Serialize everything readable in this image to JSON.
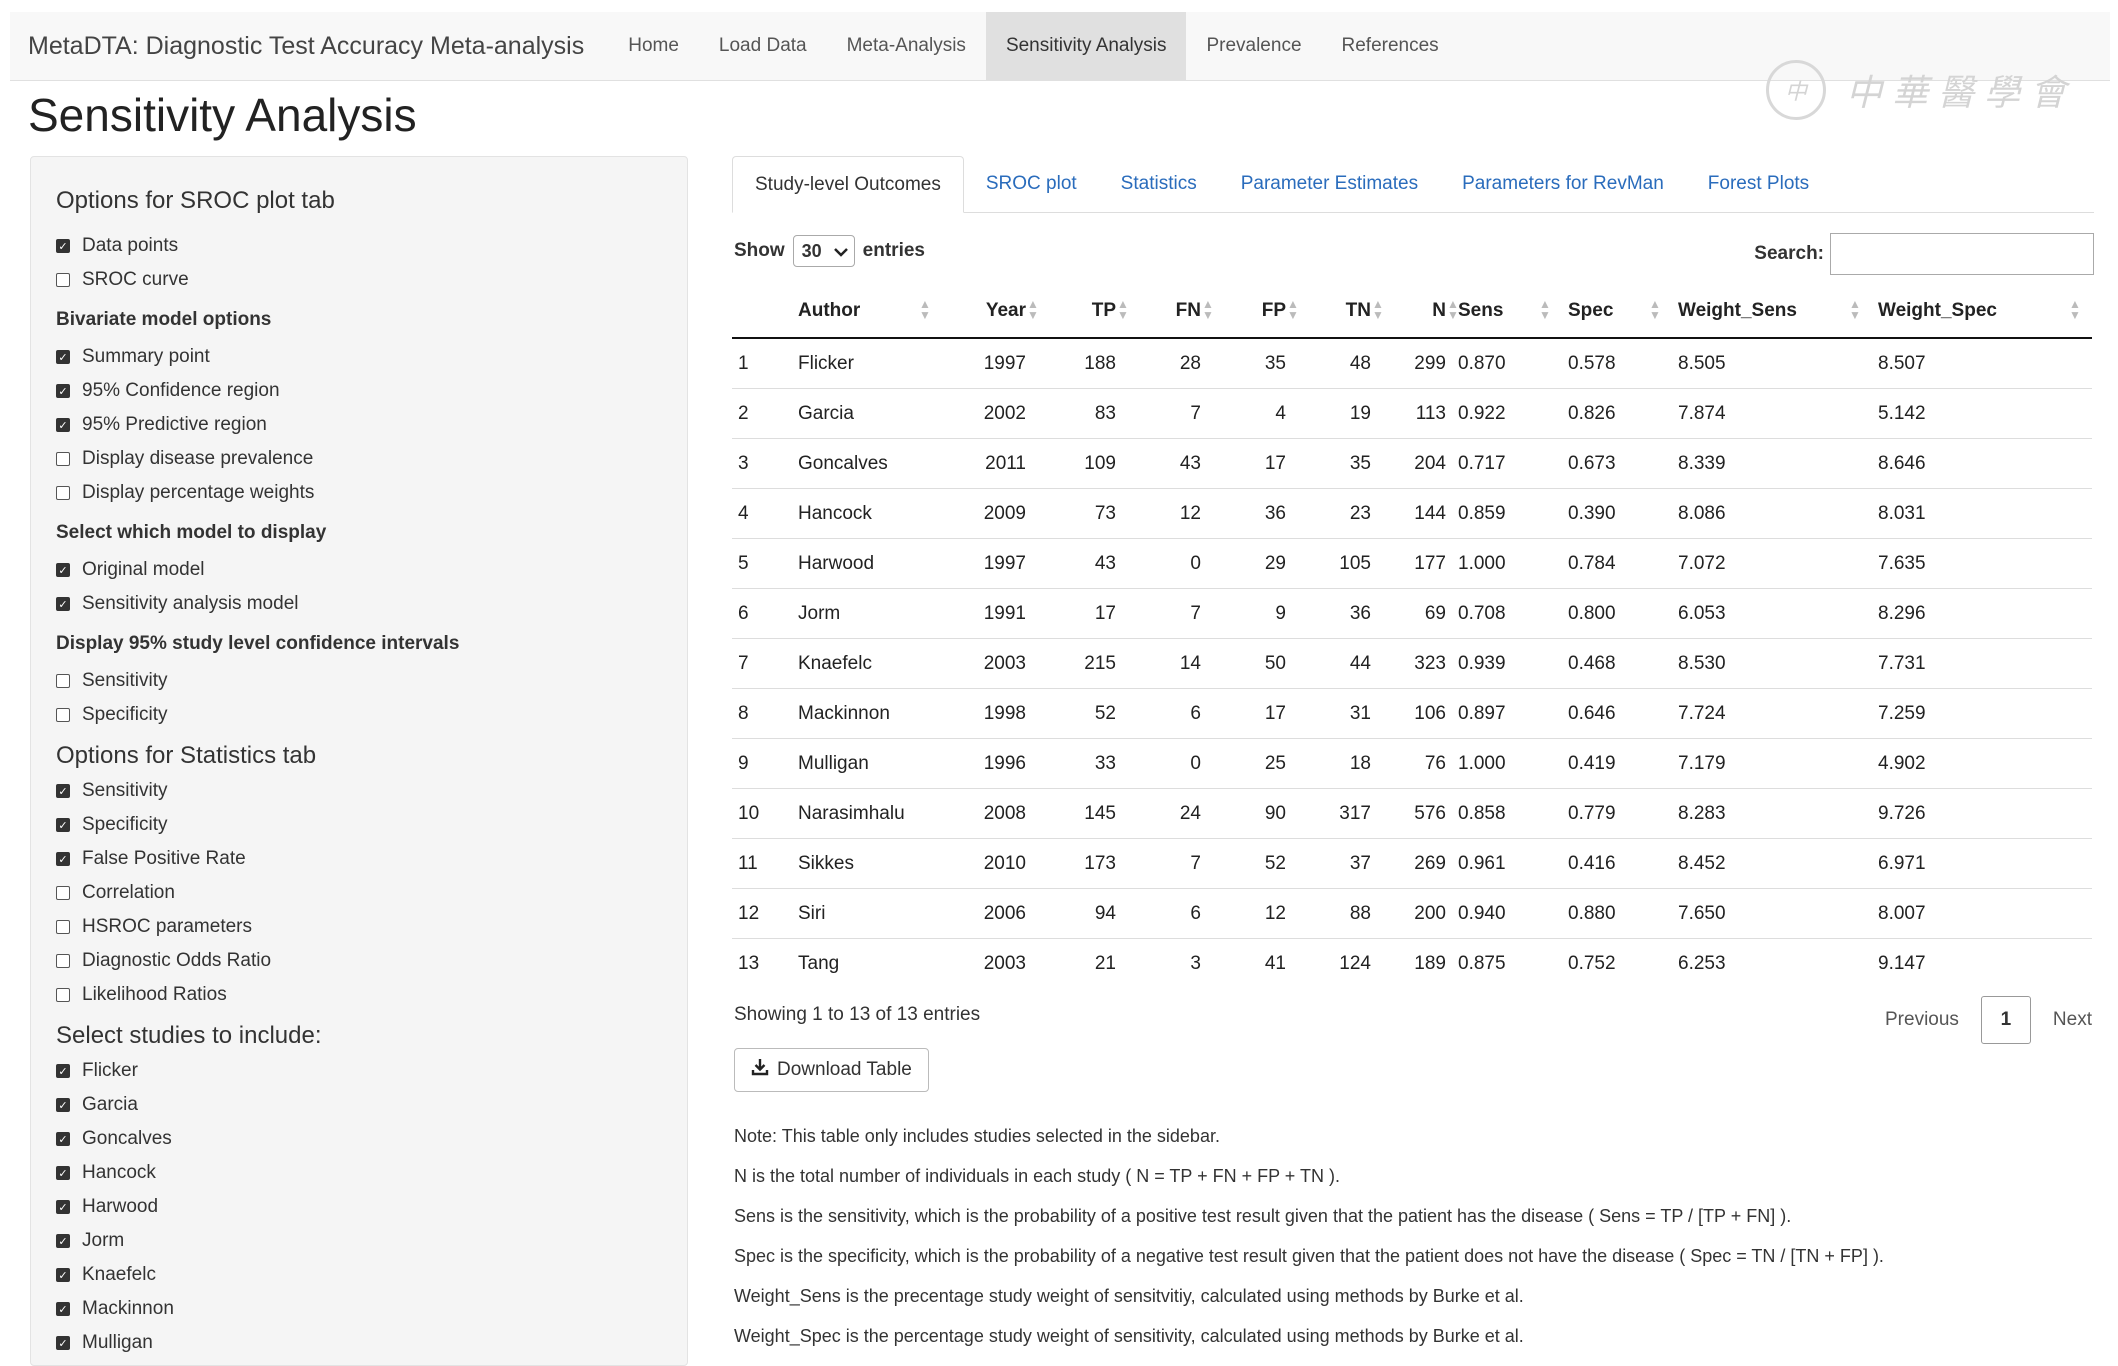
{
  "navbar": {
    "brand": "MetaDTA: Diagnostic Test Accuracy Meta-analysis",
    "items": [
      {
        "label": "Home",
        "active": false
      },
      {
        "label": "Load Data",
        "active": false
      },
      {
        "label": "Meta-Analysis",
        "active": false
      },
      {
        "label": "Sensitivity Analysis",
        "active": true
      },
      {
        "label": "Prevalence",
        "active": false
      },
      {
        "label": "References",
        "active": false
      }
    ]
  },
  "watermark": {
    "seal_text": "中",
    "text": "中華醫學會"
  },
  "page_title": "Sensitivity Analysis",
  "sidebar": {
    "sroc_title": "Options for SROC plot tab",
    "sroc_options": [
      {
        "label": "Data points",
        "checked": true
      },
      {
        "label": "SROC curve",
        "checked": false
      }
    ],
    "bivariate_title": "Bivariate model options",
    "bivariate_options": [
      {
        "label": "Summary point",
        "checked": true
      },
      {
        "label": "95% Confidence region",
        "checked": true
      },
      {
        "label": "95% Predictive region",
        "checked": true
      },
      {
        "label": "Display disease prevalence",
        "checked": false
      },
      {
        "label": "Display percentage weights",
        "checked": false
      }
    ],
    "model_title": "Select which model to display",
    "model_options": [
      {
        "label": "Original model",
        "checked": true
      },
      {
        "label": "Sensitivity analysis model",
        "checked": true
      }
    ],
    "ci_title": "Display 95% study level confidence intervals",
    "ci_options": [
      {
        "label": "Sensitivity",
        "checked": false
      },
      {
        "label": "Specificity",
        "checked": false
      }
    ],
    "stats_title": "Options for Statistics tab",
    "stats_options": [
      {
        "label": "Sensitivity",
        "checked": true
      },
      {
        "label": "Specificity",
        "checked": true
      },
      {
        "label": "False Positive Rate",
        "checked": true
      },
      {
        "label": "Correlation",
        "checked": false
      },
      {
        "label": "HSROC parameters",
        "checked": false
      },
      {
        "label": "Diagnostic Odds Ratio",
        "checked": false
      },
      {
        "label": "Likelihood Ratios",
        "checked": false
      }
    ],
    "studies_title": "Select studies to include:",
    "studies": [
      {
        "label": "Flicker",
        "checked": true
      },
      {
        "label": "Garcia",
        "checked": true
      },
      {
        "label": "Goncalves",
        "checked": true
      },
      {
        "label": "Hancock",
        "checked": true
      },
      {
        "label": "Harwood",
        "checked": true
      },
      {
        "label": "Jorm",
        "checked": true
      },
      {
        "label": "Knaefelc",
        "checked": true
      },
      {
        "label": "Mackinnon",
        "checked": true
      },
      {
        "label": "Mulligan",
        "checked": true
      }
    ]
  },
  "tabs": [
    {
      "label": "Study-level Outcomes",
      "active": true
    },
    {
      "label": "SROC plot",
      "active": false
    },
    {
      "label": "Statistics",
      "active": false
    },
    {
      "label": "Parameter Estimates",
      "active": false
    },
    {
      "label": "Parameters for RevMan",
      "active": false
    },
    {
      "label": "Forest Plots",
      "active": false
    }
  ],
  "table_controls": {
    "show_label": "Show",
    "entries_value": "30",
    "entries_label": "entries",
    "search_label": "Search:",
    "search_value": ""
  },
  "table": {
    "columns": [
      "",
      "Author",
      "Year",
      "TP",
      "FN",
      "FP",
      "TN",
      "N",
      "Sens",
      "Spec",
      "Weight_Sens",
      "Weight_Spec"
    ],
    "rows": [
      [
        "1",
        "Flicker",
        "1997",
        "188",
        "28",
        "35",
        "48",
        "299",
        "0.870",
        "0.578",
        "8.505",
        "8.507"
      ],
      [
        "2",
        "Garcia",
        "2002",
        "83",
        "7",
        "4",
        "19",
        "113",
        "0.922",
        "0.826",
        "7.874",
        "5.142"
      ],
      [
        "3",
        "Goncalves",
        "2011",
        "109",
        "43",
        "17",
        "35",
        "204",
        "0.717",
        "0.673",
        "8.339",
        "8.646"
      ],
      [
        "4",
        "Hancock",
        "2009",
        "73",
        "12",
        "36",
        "23",
        "144",
        "0.859",
        "0.390",
        "8.086",
        "8.031"
      ],
      [
        "5",
        "Harwood",
        "1997",
        "43",
        "0",
        "29",
        "105",
        "177",
        "1.000",
        "0.784",
        "7.072",
        "7.635"
      ],
      [
        "6",
        "Jorm",
        "1991",
        "17",
        "7",
        "9",
        "36",
        "69",
        "0.708",
        "0.800",
        "6.053",
        "8.296"
      ],
      [
        "7",
        "Knaefelc",
        "2003",
        "215",
        "14",
        "50",
        "44",
        "323",
        "0.939",
        "0.468",
        "8.530",
        "7.731"
      ],
      [
        "8",
        "Mackinnon",
        "1998",
        "52",
        "6",
        "17",
        "31",
        "106",
        "0.897",
        "0.646",
        "7.724",
        "7.259"
      ],
      [
        "9",
        "Mulligan",
        "1996",
        "33",
        "0",
        "25",
        "18",
        "76",
        "1.000",
        "0.419",
        "7.179",
        "4.902"
      ],
      [
        "10",
        "Narasimhalu",
        "2008",
        "145",
        "24",
        "90",
        "317",
        "576",
        "0.858",
        "0.779",
        "8.283",
        "9.726"
      ],
      [
        "11",
        "Sikkes",
        "2010",
        "173",
        "7",
        "52",
        "37",
        "269",
        "0.961",
        "0.416",
        "8.452",
        "6.971"
      ],
      [
        "12",
        "Siri",
        "2006",
        "94",
        "6",
        "12",
        "88",
        "200",
        "0.940",
        "0.880",
        "7.650",
        "8.007"
      ],
      [
        "13",
        "Tang",
        "2003",
        "21",
        "3",
        "41",
        "124",
        "189",
        "0.875",
        "0.752",
        "6.253",
        "9.147"
      ]
    ]
  },
  "table_footer": {
    "info": "Showing 1 to 13 of 13 entries",
    "previous": "Previous",
    "current_page": "1",
    "next": "Next"
  },
  "download_label": "Download Table",
  "notes": [
    "Note: This table only includes studies selected in the sidebar.",
    "N is the total number of individuals in each study ( N = TP + FN + FP + TN ).",
    "Sens is the sensitivity, which is the probability of a positive test result given that the patient has the disease ( Sens = TP / [TP + FN] ).",
    "Spec is the specificity, which is the probability of a negative test result given that the patient does not have the disease ( Spec = TN / [TN + FP] ).",
    "Weight_Sens is the precentage study weight of sensitvitiy, calculated using methods by Burke et al.",
    "Weight_Spec is the percentage study weight of sensitivity, calculated using methods by Burke et al."
  ]
}
